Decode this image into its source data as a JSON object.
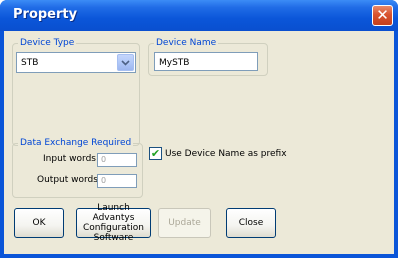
{
  "window": {
    "title": "Property",
    "close_glyph": "✕"
  },
  "device_type": {
    "group_label": "Device Type",
    "selected": "STB",
    "dropdown_icon": "chevron-down-icon"
  },
  "device_name": {
    "group_label": "Device Name",
    "value": "MySTB"
  },
  "data_exchange": {
    "group_label": "Data Exchange Required",
    "input_label": "Input words",
    "input_value": "0",
    "output_label": "Output words",
    "output_value": "0"
  },
  "prefix_checkbox": {
    "label": "Use Device Name as prefix",
    "checked": true,
    "check_glyph": "✔"
  },
  "buttons": {
    "ok": "OK",
    "launch_line1": "Launch Advantys",
    "launch_line2": "Configuration",
    "launch_line3": "Software",
    "update": "Update",
    "close": "Close"
  },
  "colors": {
    "titlebar": "#0a55d8",
    "group_label": "#0046d5",
    "dialog_bg": "#ece9d8",
    "close_button": "#d9532f",
    "check": "#21a121"
  }
}
